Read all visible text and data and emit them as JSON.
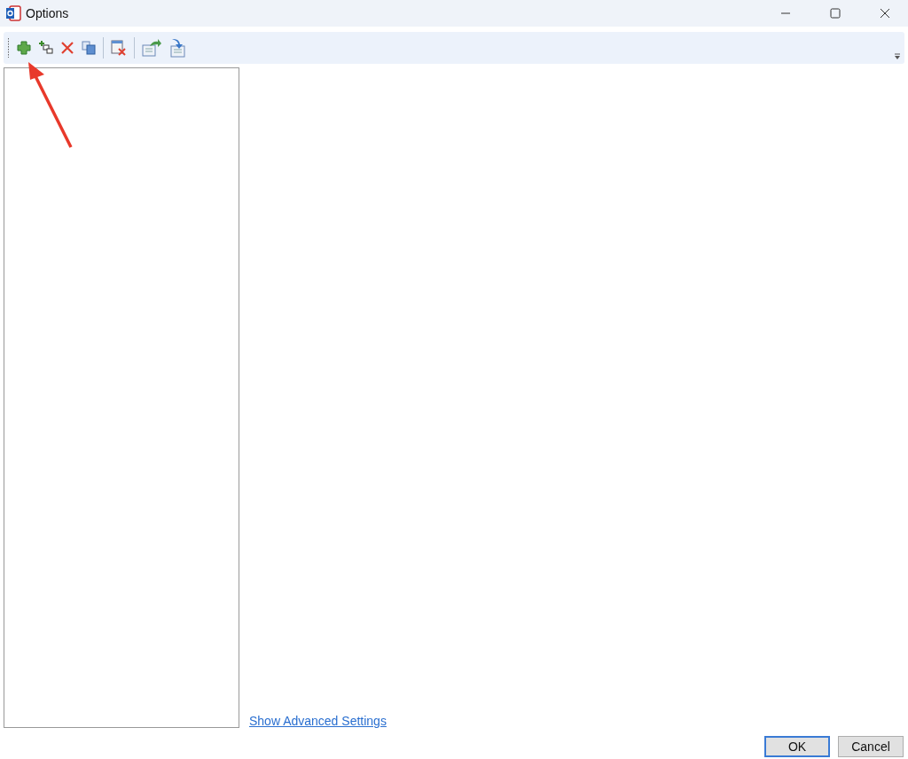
{
  "window": {
    "title": "Options"
  },
  "link": "Show Advanced Settings",
  "buttons": [
    {
      "label": "OK",
      "default": true
    },
    {
      "label": "Cancel",
      "default": false
    }
  ]
}
